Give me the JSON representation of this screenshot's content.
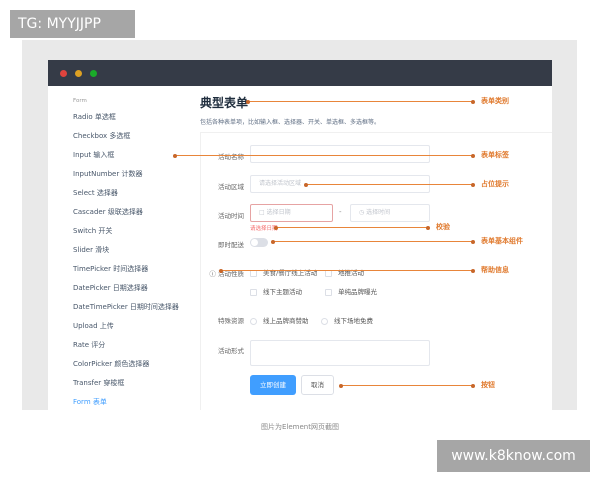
{
  "watermark": "TG: MYYJJPP",
  "site": "www.k8know.com",
  "caption": "图片为Element网页截图",
  "colors": {
    "accent": "#409eff",
    "annotation": "#e8853a",
    "titlebar": "#353b47",
    "error": "#f56c6c"
  },
  "window_dots": [
    "#e0443e",
    "#dea123",
    "#1aab29"
  ],
  "sidebar": {
    "group": "Form",
    "items": [
      "Radio 单选框",
      "Checkbox 多选框",
      "Input 输入框",
      "InputNumber 计数器",
      "Select 选择器",
      "Cascader 级联选择器",
      "Switch 开关",
      "Slider 滑块",
      "TimePicker 时间选择器",
      "DatePicker 日期选择器",
      "DateTimePicker 日期时间选择器",
      "Upload 上传",
      "Rate 评分",
      "ColorPicker 颜色选择器",
      "Transfer 穿梭框",
      "Form 表单"
    ],
    "active": "Form 表单"
  },
  "main": {
    "title": "典型表单",
    "desc": "包括各种表单项，比如输入框、选择器、开关、单选框、多选框等。",
    "form": {
      "name_label": "活动名称",
      "region_label": "活动区域",
      "region_placeholder": "请选择活动区域",
      "time_label": "活动时间",
      "date_placeholder": "选择日期",
      "sep": "-",
      "time_placeholder": "选择时间",
      "date_error": "请选择日期",
      "delivery_label": "即时配送",
      "delivery_on": false,
      "type_label": "活动性质",
      "type_options": [
        "美食/餐厅线上活动",
        "地推活动",
        "线下主题活动",
        "单纯品牌曝光"
      ],
      "resource_label": "特殊资源",
      "resource_options": [
        "线上品牌商赞助",
        "线下场地免费"
      ],
      "form_label": "活动形式",
      "submit": "立即创建",
      "cancel": "取消"
    }
  },
  "annotations": [
    "表单类别",
    "表单标签",
    "占位提示",
    "校验",
    "表单基本组件",
    "帮助信息",
    "按钮"
  ]
}
